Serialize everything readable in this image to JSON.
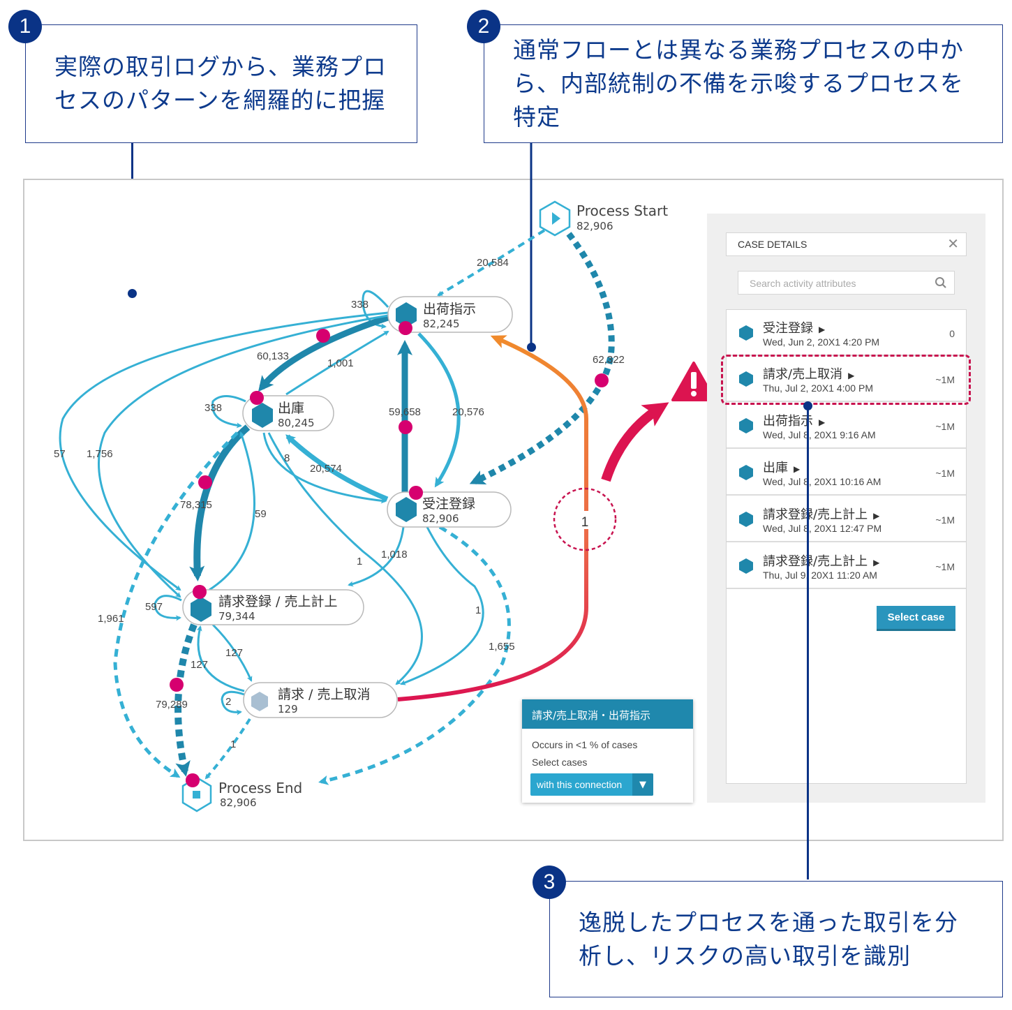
{
  "callouts": [
    {
      "number": "1",
      "lines": [
        "実際の取引ログから、業務プロ",
        "セスのパターンを網羅的に把握"
      ]
    },
    {
      "number": "2",
      "lines": [
        "通常フローとは異なる業務プロセスの中か",
        "ら、内部統制の不備を示唆するプロセスを",
        "特定"
      ]
    },
    {
      "number": "3",
      "lines": [
        "逸脱したプロセスを通った取引を分",
        "析し、リスクの高い取引を識別"
      ]
    }
  ],
  "colors": {
    "callout_blue": "#0a3386",
    "edge_light": "#35b0d4",
    "edge_dark": "#1f87ab",
    "highlight_magenta": "#d6006f",
    "deviation_orange": "#f08a2c",
    "deviation_red": "#dc1450",
    "hex_inactive": "#a9bfd2"
  },
  "process_map": {
    "nodes": {
      "start": {
        "label": "Process Start",
        "count": "82,906",
        "icon": "play-hexagon-icon"
      },
      "shukka": {
        "label": "出荷指示",
        "count": "82,245"
      },
      "shukko": {
        "label": "出庫",
        "count": "80,245"
      },
      "juchu": {
        "label": "受注登録",
        "count": "82,906"
      },
      "seikyu": {
        "label": "請求登録 / 売上計上",
        "count": "79,344"
      },
      "torikeshi": {
        "label": "請求 / 売上取消",
        "count": "129"
      },
      "end": {
        "label": "Process End",
        "count": "82,906",
        "icon": "stop-hexagon-icon"
      }
    },
    "edge_labels": {
      "start_shukka": "20,584",
      "start_juchu": "62,322",
      "shukka_self": "338",
      "shukka_shukko": "60,133",
      "shukko_shukka": "1,001",
      "shukko_self": "338",
      "juchu_shukka": "59,658",
      "shukka_juchu": "20,576",
      "juchu_shukko": "20,574",
      "shukko_juchu": "8",
      "shukko_seikyu": "78,315",
      "seikyu_shukko": "59",
      "shukka_seikyu_a": "57",
      "shukka_seikyu_b": "1,756",
      "seikyu_self": "597",
      "shukko_end": "1,961",
      "juchu_seikyu": "1,018",
      "shukko_torikeshi": "1",
      "juchu_torikeshi": "1",
      "juchu_end": "1,655",
      "seikyu_torikeshi": "127",
      "torikeshi_seikyu": "127",
      "torikeshi_self": "2",
      "seikyu_end": "79,289",
      "torikeshi_end": "1",
      "torikeshi_shukka": "1"
    }
  },
  "connection_popup": {
    "title": "請求/売上取消・出荷指示",
    "occurs": "Occurs in <1 % of cases",
    "select_label": "Select cases",
    "dropdown_value": "with this connection"
  },
  "case_panel": {
    "title": "CASE DETAILS",
    "search_placeholder": "Search activity attributes",
    "rows": [
      {
        "activity": "受注登録",
        "time": "Wed, Jun 2, 20X1 4:20 PM",
        "duration": "0"
      },
      {
        "activity": "請求/売上取消",
        "time": "Thu, Jul 2, 20X1 4:00 PM",
        "duration": "~1M",
        "highlighted": true
      },
      {
        "activity": "出荷指示",
        "time": "Wed, Jul 8, 20X1 9:16 AM",
        "duration": "~1M"
      },
      {
        "activity": "出庫",
        "time": "Wed, Jul 8, 20X1 10:16 AM",
        "duration": "~1M"
      },
      {
        "activity": "請求登録/売上計上",
        "time": "Wed, Jul 8, 20X1 12:47 PM",
        "duration": "~1M"
      },
      {
        "activity": "請求登録/売上計上",
        "time": "Thu, Jul 9, 20X1 11:20 AM",
        "duration": "~1M"
      }
    ],
    "select_button": "Select case"
  }
}
